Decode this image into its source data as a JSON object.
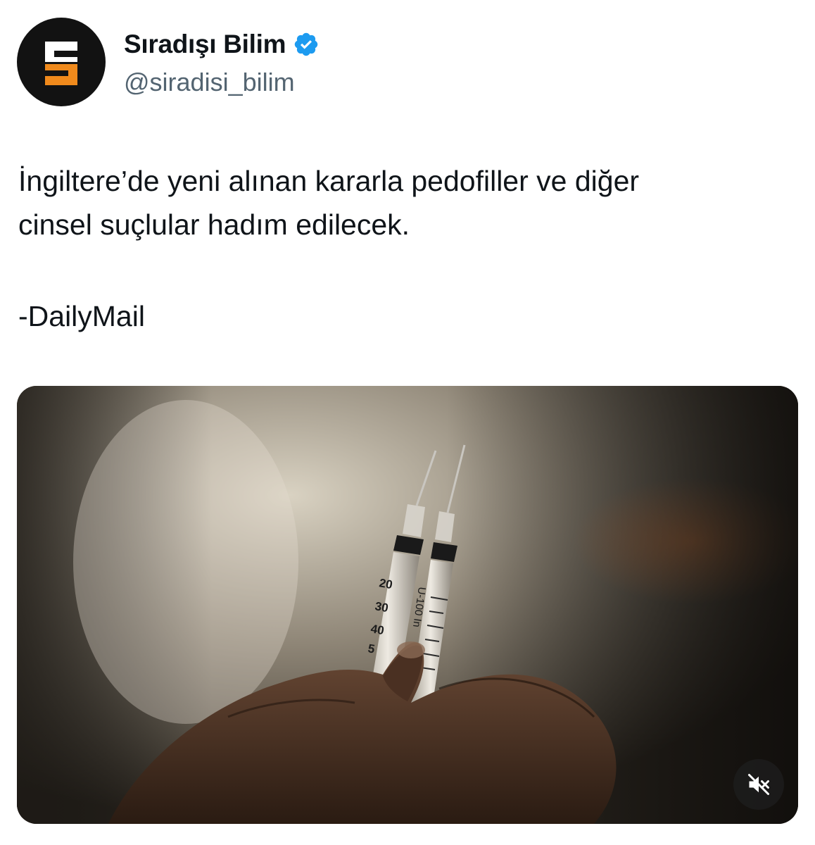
{
  "author": {
    "display_name": "Sıradışı Bilim",
    "handle": "@siradisi_bilim",
    "verified": true,
    "avatar_icon": "sb-logo-icon",
    "avatar_colors": {
      "background": "#121212",
      "top": "#ffffff",
      "bottom": "#f08a1c"
    }
  },
  "tweet": {
    "lines": [
      "İngiltere’de yeni alınan kararla pedofiller ve diğer",
      "cinsel suçlular hadım edilecek."
    ],
    "source": "-DailyMail"
  },
  "media": {
    "type": "video",
    "description_icon": "syringes-photo",
    "syringe_left_marks": [
      "20",
      "30",
      "40",
      "5"
    ],
    "syringe_right_mark": "U-100 In",
    "mute_icon": "volume-muted-icon"
  },
  "colors": {
    "text": "#0f1419",
    "secondary": "#536471",
    "verified": "#1d9bf0"
  }
}
